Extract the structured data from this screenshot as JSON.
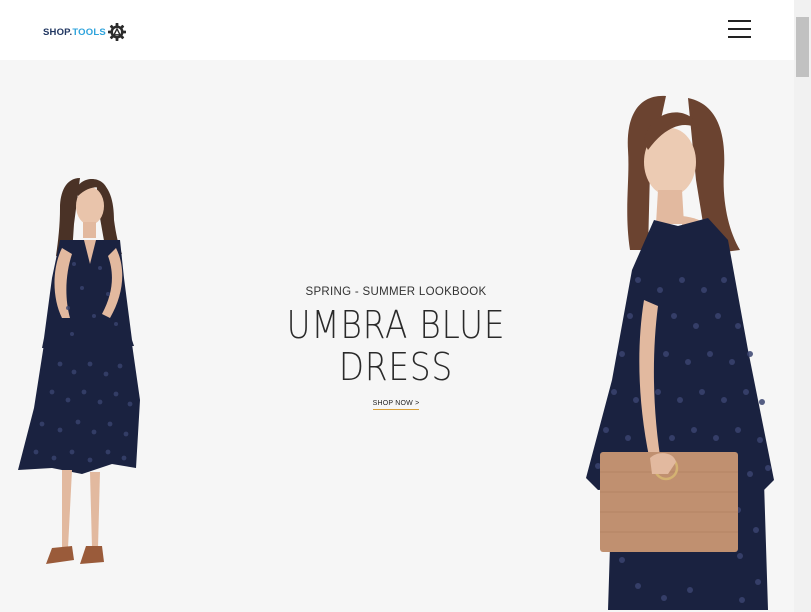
{
  "header": {
    "logo": {
      "part1": "SHOP.",
      "part2": "TOOLS"
    },
    "menu_icon": "hamburger-menu-icon"
  },
  "hero": {
    "subtitle": "SPRING - SUMMER LOOKBOOK",
    "title_line1": "UMBRA BLUE",
    "title_line2": "DRESS",
    "cta": "SHOP NOW >"
  },
  "colors": {
    "logo_dark": "#1f3560",
    "logo_accent": "#2ea3dc",
    "hero_bg": "#f6f6f6",
    "dress": "#1a2240",
    "cta_underline": "#d9a038"
  }
}
